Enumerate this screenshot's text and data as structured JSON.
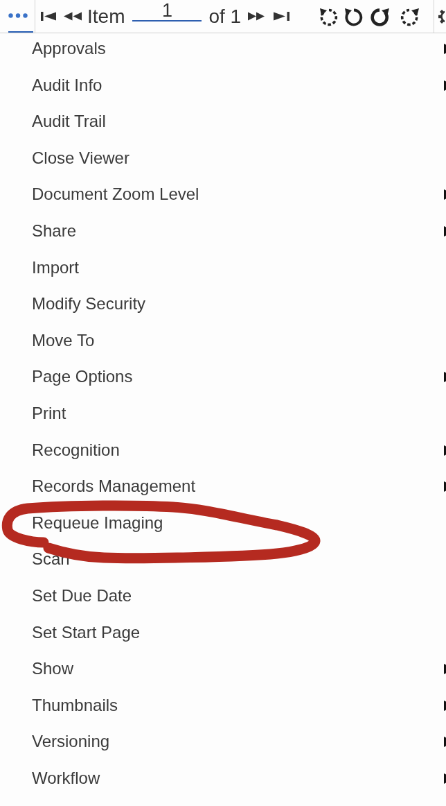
{
  "toolbar": {
    "more_button": {
      "selected": true
    },
    "item_label": "Item",
    "page_field": {
      "value": "1"
    },
    "of_label": "of 1"
  },
  "menu": {
    "items": [
      {
        "label": "Approvals",
        "submenu": true,
        "circled": false
      },
      {
        "label": "Audit Info",
        "submenu": true,
        "circled": false
      },
      {
        "label": "Audit Trail",
        "submenu": false,
        "circled": false
      },
      {
        "label": "Close Viewer",
        "submenu": false,
        "circled": false
      },
      {
        "label": "Document Zoom Level",
        "submenu": true,
        "circled": false
      },
      {
        "label": "Share",
        "submenu": true,
        "circled": false
      },
      {
        "label": "Import",
        "submenu": false,
        "circled": false
      },
      {
        "label": "Modify Security",
        "submenu": false,
        "circled": false
      },
      {
        "label": "Move To",
        "submenu": false,
        "circled": false
      },
      {
        "label": "Page Options",
        "submenu": true,
        "circled": false
      },
      {
        "label": "Print",
        "submenu": false,
        "circled": false
      },
      {
        "label": "Recognition",
        "submenu": true,
        "circled": false
      },
      {
        "label": "Records Management",
        "submenu": true,
        "circled": false
      },
      {
        "label": "Requeue Imaging",
        "submenu": false,
        "circled": true
      },
      {
        "label": "Scan",
        "submenu": false,
        "circled": false
      },
      {
        "label": "Set Due Date",
        "submenu": false,
        "circled": false
      },
      {
        "label": "Set Start Page",
        "submenu": false,
        "circled": false
      },
      {
        "label": "Show",
        "submenu": true,
        "circled": false
      },
      {
        "label": "Thumbnails",
        "submenu": true,
        "circled": false
      },
      {
        "label": "Versioning",
        "submenu": true,
        "circled": false
      },
      {
        "label": "Workflow",
        "submenu": true,
        "circled": false
      }
    ]
  }
}
